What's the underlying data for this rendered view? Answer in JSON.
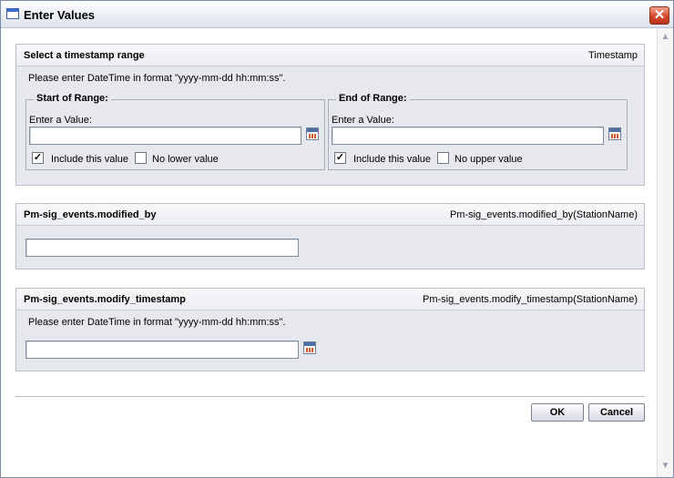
{
  "window": {
    "title": "Enter Values",
    "close_glyph": "✕"
  },
  "scrollbar": {
    "up_glyph": "▲",
    "down_glyph": "▼"
  },
  "panel1": {
    "title": "Select a timestamp range",
    "right_label": "Timestamp",
    "hint": "Please enter DateTime in format \"yyyy-mm-dd hh:mm:ss\".",
    "start": {
      "legend": "Start of Range:",
      "label": "Enter a Value:",
      "value": "",
      "include_label": "Include this value",
      "include_checked": true,
      "include_glyph": "✓",
      "nobound_label": "No lower value",
      "nobound_checked": false,
      "nobound_glyph": ""
    },
    "end": {
      "legend": "End of Range:",
      "label": "Enter a Value:",
      "value": "",
      "include_label": "Include this value",
      "include_checked": true,
      "include_glyph": "✓",
      "nobound_label": "No upper value",
      "nobound_checked": false,
      "nobound_glyph": ""
    }
  },
  "panel2": {
    "title": "Pm-sig_events.modified_by",
    "right_label": "Pm-sig_events.modified_by(StationName)",
    "value": ""
  },
  "panel3": {
    "title": "Pm-sig_events.modify_timestamp",
    "right_label": "Pm-sig_events.modify_timestamp(StationName)",
    "hint": "Please enter DateTime in format \"yyyy-mm-dd hh:mm:ss\".",
    "value": ""
  },
  "buttons": {
    "ok": "OK",
    "cancel": "Cancel"
  },
  "colors": {
    "panel_bg": "#e7e8ee",
    "close_red": "#d64a2c",
    "border": "#b9bfc9"
  },
  "icons": [
    "window-icon",
    "close-icon",
    "calendar-icon",
    "scroll-up-icon",
    "scroll-down-icon"
  ]
}
